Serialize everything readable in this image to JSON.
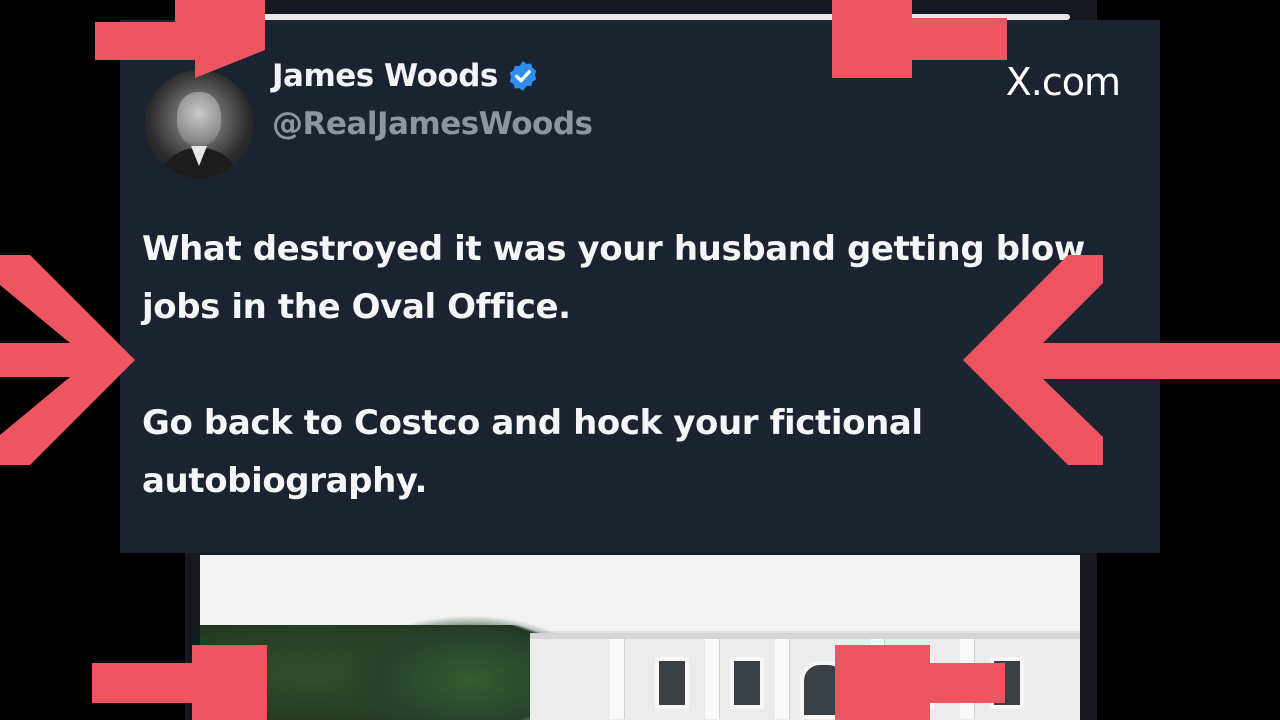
{
  "tweet": {
    "display_name": "James Woods",
    "handle": "@RealJamesWoods",
    "brand": "X.com",
    "paragraphs": [
      "What destroyed it was your husband getting blow jobs in the Oval Office.",
      "Go back to Costco and hock your fictional autobiography."
    ],
    "verified": true
  },
  "colors": {
    "card_background": "#1b2330",
    "text": "#f4f6f8",
    "handle": "#8a96a3",
    "verified_badge": "#2f8cf0",
    "arrow": "#ef5560"
  },
  "icons": [
    "verified-badge-icon",
    "avatar",
    "red-arrow-icon"
  ]
}
